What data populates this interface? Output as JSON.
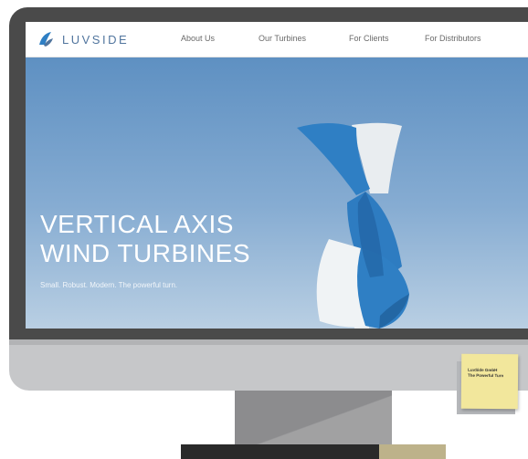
{
  "header": {
    "logo_text": "LUVSIDE",
    "nav": [
      "About Us",
      "Our Turbines",
      "For Clients",
      "For Distributors"
    ]
  },
  "hero": {
    "title_line1": "VERTICAL AXIS",
    "title_line2": "WIND TURBINES",
    "subtitle": "Small. Robust. Modern. The powerful turn."
  },
  "note": {
    "line1": "LuvSide GmbH",
    "line2": "The Powerful Turn"
  },
  "colors": {
    "brand": "#51759e",
    "sky_top": "#5e90c2",
    "turbine_blue": "#2f7fc4",
    "bezel": "#4a4a4a"
  }
}
